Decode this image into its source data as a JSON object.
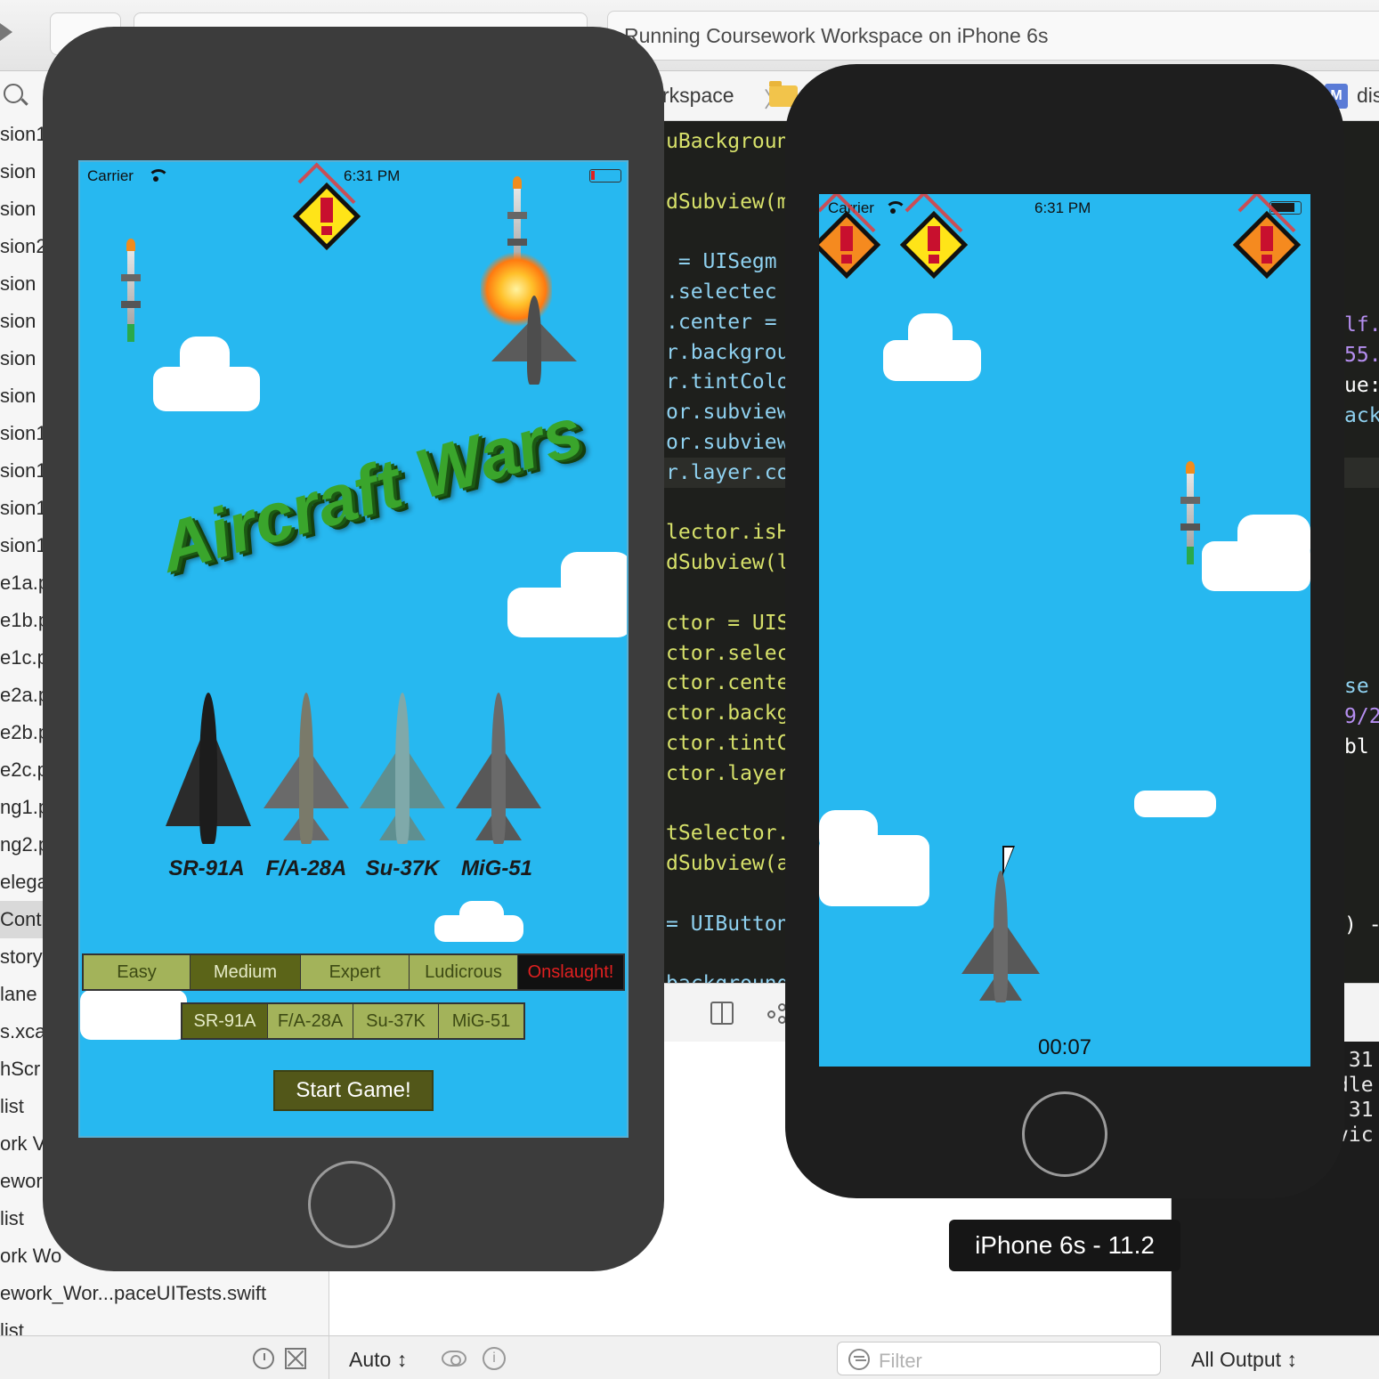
{
  "toolbar": {
    "activity_text": "Running Coursework Workspace on iPhone 6s"
  },
  "jumpbar": {
    "crumb": "rkspace",
    "sep": "〉",
    "right_fragment": "dis",
    "file_badge": "M"
  },
  "navigator": {
    "rows": [
      "sion1",
      "sion",
      "sion",
      "sion2",
      "sion",
      "sion",
      "sion",
      "sion",
      "sion1",
      "sion1",
      "sion1",
      "sion1",
      "e1a.p",
      "e1b.p",
      "e1c.p",
      "e2a.p",
      "e2b.p",
      "e2c.p",
      "ng1.p",
      "ng2.p",
      "elega",
      "Contr",
      "story",
      "lane",
      "s.xca",
      "hScr",
      "list",
      "ork V",
      "ewor",
      "list",
      "ork Wo",
      "ework_Wor...paceUITests.swift",
      "list"
    ],
    "selected_index": 21
  },
  "editor": {
    "lines": [
      {
        "text": "uBackgroun",
        "color": "#d7e16a"
      },
      {
        "text": "",
        "color": "#ffffff"
      },
      {
        "text": "dSubview(m",
        "color": "#d7e16a"
      },
      {
        "text": "",
        "color": "#ffffff"
      },
      {
        "text": " = UISegm",
        "color": "#8fd1f0"
      },
      {
        "text": ".selectec",
        "color": "#8fd1f0"
      },
      {
        "text": ".center =",
        "color": "#8fd1f0"
      },
      {
        "text": "r.backgrou",
        "color": "#8fd1f0"
      },
      {
        "text": "r.tintColo",
        "color": "#8fd1f0"
      },
      {
        "text": "or.subview",
        "color": "#8fd1f0"
      },
      {
        "text": "or.subview",
        "color": "#8fd1f0"
      },
      {
        "text": "r.layer.co",
        "color": "#8fd1f0"
      },
      {
        "text": "",
        "color": "#ffffff"
      },
      {
        "text": "lector.isH",
        "color": "#d7e16a"
      },
      {
        "text": "dSubview(l",
        "color": "#d7e16a"
      },
      {
        "text": "",
        "color": "#ffffff"
      },
      {
        "text": "ctor = UIS",
        "color": "#d7e16a"
      },
      {
        "text": "ctor.selec",
        "color": "#d7e16a"
      },
      {
        "text": "ctor.cente",
        "color": "#d7e16a"
      },
      {
        "text": "ctor.backg",
        "color": "#d7e16a"
      },
      {
        "text": "ctor.tintC",
        "color": "#d7e16a"
      },
      {
        "text": "ctor.layer",
        "color": "#d7e16a"
      },
      {
        "text": "",
        "color": "#ffffff"
      },
      {
        "text": "tSelector.",
        "color": "#d7e16a"
      },
      {
        "text": "dSubview(a",
        "color": "#d7e16a"
      },
      {
        "text": "",
        "color": "#ffffff"
      },
      {
        "text": "= UIButton",
        "color": "#8fd1f0"
      },
      {
        "text": "",
        "color": "#ffffff"
      },
      {
        "text": "backgroundC",
        "color": "#8fd1f0"
      }
    ],
    "right_lines": [
      {
        "text": "lf.",
        "color": "#b58ef0"
      },
      {
        "text": "55.",
        "color": "#b58ef0"
      },
      {
        "text": "ue:",
        "color": "#ffffff"
      },
      {
        "text": "ack",
        "color": "#8fd1f0"
      },
      {
        "text": "se",
        "color": "#8fd1f0"
      },
      {
        "text": "9/2",
        "color": "#b58ef0"
      },
      {
        "text": "bl",
        "color": "#ffffff"
      },
      {
        "text": ") -",
        "color": "#ffffff"
      }
    ]
  },
  "console": {
    "lines": [
      ":31",
      "dle",
      ":31",
      "vic"
    ]
  },
  "bottom": {
    "auto_label": "Auto ↕",
    "filter_placeholder": "Filter",
    "all_output_label": "All Output ↕"
  },
  "sim_left": {
    "carrier": "Carrier",
    "time": "6:31 PM",
    "title": "Aircraft Wars",
    "planes": [
      "SR-91A",
      "F/A-28A",
      "Su-37K",
      "MiG-51"
    ],
    "difficulty": {
      "options": [
        "Easy",
        "Medium",
        "Expert",
        "Ludicrous",
        "Onslaught!"
      ],
      "selected": "Medium"
    },
    "aircraft": {
      "options": [
        "SR-91A",
        "F/A-28A",
        "Su-37K",
        "MiG-51"
      ],
      "selected": "SR-91A"
    },
    "start_label": "Start Game!"
  },
  "sim_right": {
    "carrier": "Carrier",
    "time": "6:31 PM",
    "timer": "00:07"
  },
  "device_tooltip": "iPhone 6s - 11.2",
  "colors": {
    "sky": "#27b8f0",
    "seg_bg": "#a3b35a",
    "seg_selected": "#5b6418",
    "onslaught_bg": "#111111",
    "onslaught_text": "#e02020",
    "title_green": "#3aa52c"
  }
}
